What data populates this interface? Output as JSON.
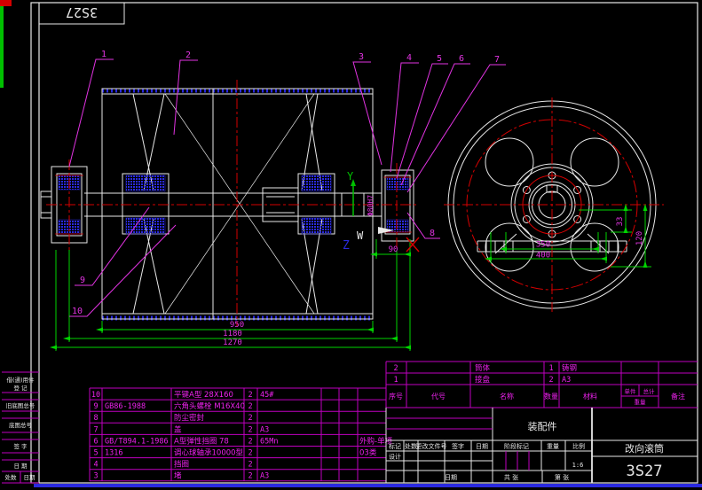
{
  "colors": {
    "background": "#000000",
    "geometry": "#e8e8e8",
    "dimension_line": "#00d400",
    "centerline": "#d40000",
    "annotation": "#e233e2",
    "hatch_blue": "#2a2ae0"
  },
  "mirror_label": "3S27",
  "ucs": {
    "y": "Y",
    "w": "W",
    "z": "Z"
  },
  "callouts": {
    "c1": "1",
    "c2": "2",
    "c3": "3",
    "c4": "4",
    "c5": "5",
    "c6": "6",
    "c7": "7",
    "c8": "8",
    "c9": "9",
    "c10": "10"
  },
  "dims": {
    "front_len": "950",
    "front_mid": "1180",
    "front_out": "1270",
    "front_brg": "90",
    "fit": "Φ80H7",
    "side_in": "350",
    "side_out": "400",
    "side_h1": "33",
    "side_h2": "120"
  },
  "left_strip": {
    "r1a": "借(通)用件",
    "r1b": "登 记",
    "r2": "旧底图总号",
    "r3": "底图总号",
    "r4": "签 字",
    "r5": "日 期",
    "r6a": "处数",
    "r6b": "日期"
  },
  "bom": {
    "header": {
      "no": "序号",
      "code": "代号",
      "name": "名称",
      "qty": "数量",
      "mat": "材料",
      "unit": "单件",
      "total": "总计",
      "weight": "重量",
      "note": "备注"
    },
    "left_rows": [
      {
        "no": "10",
        "code": "",
        "name": "平键A型 28X160",
        "qty": "2",
        "mat": "45#",
        "note": ""
      },
      {
        "no": "9",
        "code": "GB86-1988",
        "name": "六角头螺栓 M16X40",
        "qty": "2",
        "mat": "",
        "note": ""
      },
      {
        "no": "8",
        "code": "",
        "name": "防尘密封",
        "qty": "2",
        "mat": "",
        "note": ""
      },
      {
        "no": "7",
        "code": "",
        "name": "盖",
        "qty": "2",
        "mat": "A3",
        "note": ""
      },
      {
        "no": "6",
        "code": "GB/T894.1-1986",
        "name": "A型弹性挡圈 78",
        "qty": "2",
        "mat": "65Mn",
        "note": "外购-单项"
      },
      {
        "no": "5",
        "code": "1316",
        "name": "调心球轴承10000型",
        "qty": "2",
        "mat": "",
        "note": "03类"
      },
      {
        "no": "4",
        "code": "",
        "name": "挡圈",
        "qty": "2",
        "mat": "",
        "note": ""
      },
      {
        "no": "3",
        "code": "",
        "name": "堵",
        "qty": "2",
        "mat": "A3",
        "note": ""
      }
    ],
    "right_rows": [
      {
        "no": "2",
        "code": "",
        "name": "筒体",
        "qty": "1",
        "mat": "铸钢",
        "note": ""
      },
      {
        "no": "1",
        "code": "",
        "name": "接盘",
        "qty": "2",
        "mat": "A3",
        "note": ""
      }
    ]
  },
  "title_block": {
    "change_header": {
      "mark": "标记",
      "count": "处数",
      "file": "更改文件号",
      "sign": "签字",
      "date": "日期"
    },
    "design": "设计",
    "date_label": "日期",
    "stage": "阶段标记",
    "weight": "重量",
    "scale_label": "比例",
    "scale": "1:6",
    "sheet_total": "共 张",
    "sheet_no": "第 张",
    "part_type": "装配件",
    "title": "改向滚筒",
    "drawing_no": "3S27"
  }
}
